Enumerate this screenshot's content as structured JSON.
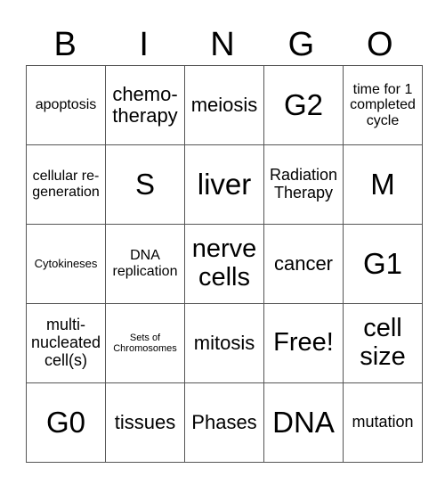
{
  "header": [
    "B",
    "I",
    "N",
    "G",
    "O"
  ],
  "rows": [
    [
      "apoptosis",
      "chemo-\ntherapy",
      "meiosis",
      "G2",
      "time for 1 completed cycle"
    ],
    [
      "cellular re-\ngeneration",
      "S",
      "liver",
      "Radiation Therapy",
      "M"
    ],
    [
      "Cytokineses",
      "DNA replication",
      "nerve cells",
      "cancer",
      "G1"
    ],
    [
      "multi-\nnucleated cell(s)",
      "Sets of Chromosomes",
      "mitosis",
      "Free!",
      "cell size"
    ],
    [
      "G0",
      "tissues",
      "Phases",
      "DNA",
      "mutation"
    ]
  ]
}
